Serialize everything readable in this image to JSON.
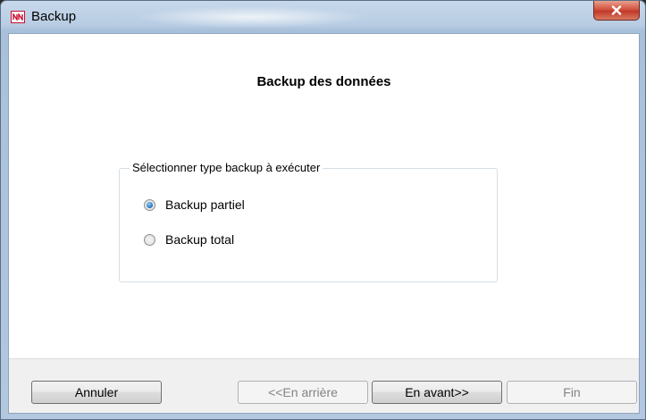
{
  "window": {
    "title": "Backup",
    "close_glyph": "x"
  },
  "heading": "Backup des données",
  "group": {
    "legend": "Sélectionner type backup à exécuter",
    "options": [
      {
        "label": "Backup partiel",
        "selected": true
      },
      {
        "label": "Backup total",
        "selected": false
      }
    ]
  },
  "buttons": {
    "cancel": "Annuler",
    "back": "<<En arrière",
    "next": "En avant>>",
    "finish": "Fin"
  },
  "colors": {
    "close_button": "#c1392a",
    "radio_selected": "#1f6fb8",
    "footer_background": "#f0f0f0"
  },
  "icons": {
    "app": "nn-logo-icon",
    "close": "close-icon"
  }
}
